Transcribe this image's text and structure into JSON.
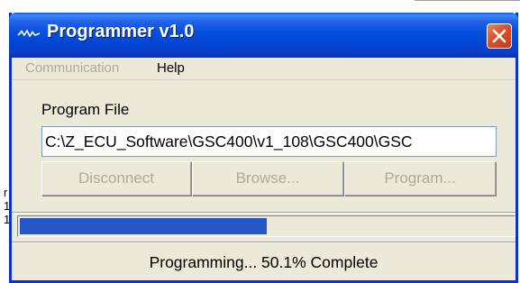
{
  "window": {
    "title": "Programmer v1.0",
    "icon": "app-icon",
    "close_icon": "close-icon"
  },
  "menu": {
    "items": [
      {
        "label": "Communication",
        "enabled": false
      },
      {
        "label": "Help",
        "enabled": true
      }
    ]
  },
  "program_file": {
    "label": "Program File",
    "value": "C:\\Z_ECU_Software\\GSC400\\v1_108\\GSC400\\GSC"
  },
  "buttons": {
    "disconnect": "Disconnect",
    "browse": "Browse...",
    "program": "Program..."
  },
  "progress": {
    "fraction": 0.501
  },
  "status": {
    "text": "Programming... 50.1% Complete"
  },
  "background": {
    "chars": [
      "r",
      "1",
      "1"
    ]
  },
  "colors": {
    "titlebar": "#0553e0",
    "progress_fill": "#2457c8",
    "close_button": "#d9502b",
    "disabled_text": "#acaa99"
  }
}
